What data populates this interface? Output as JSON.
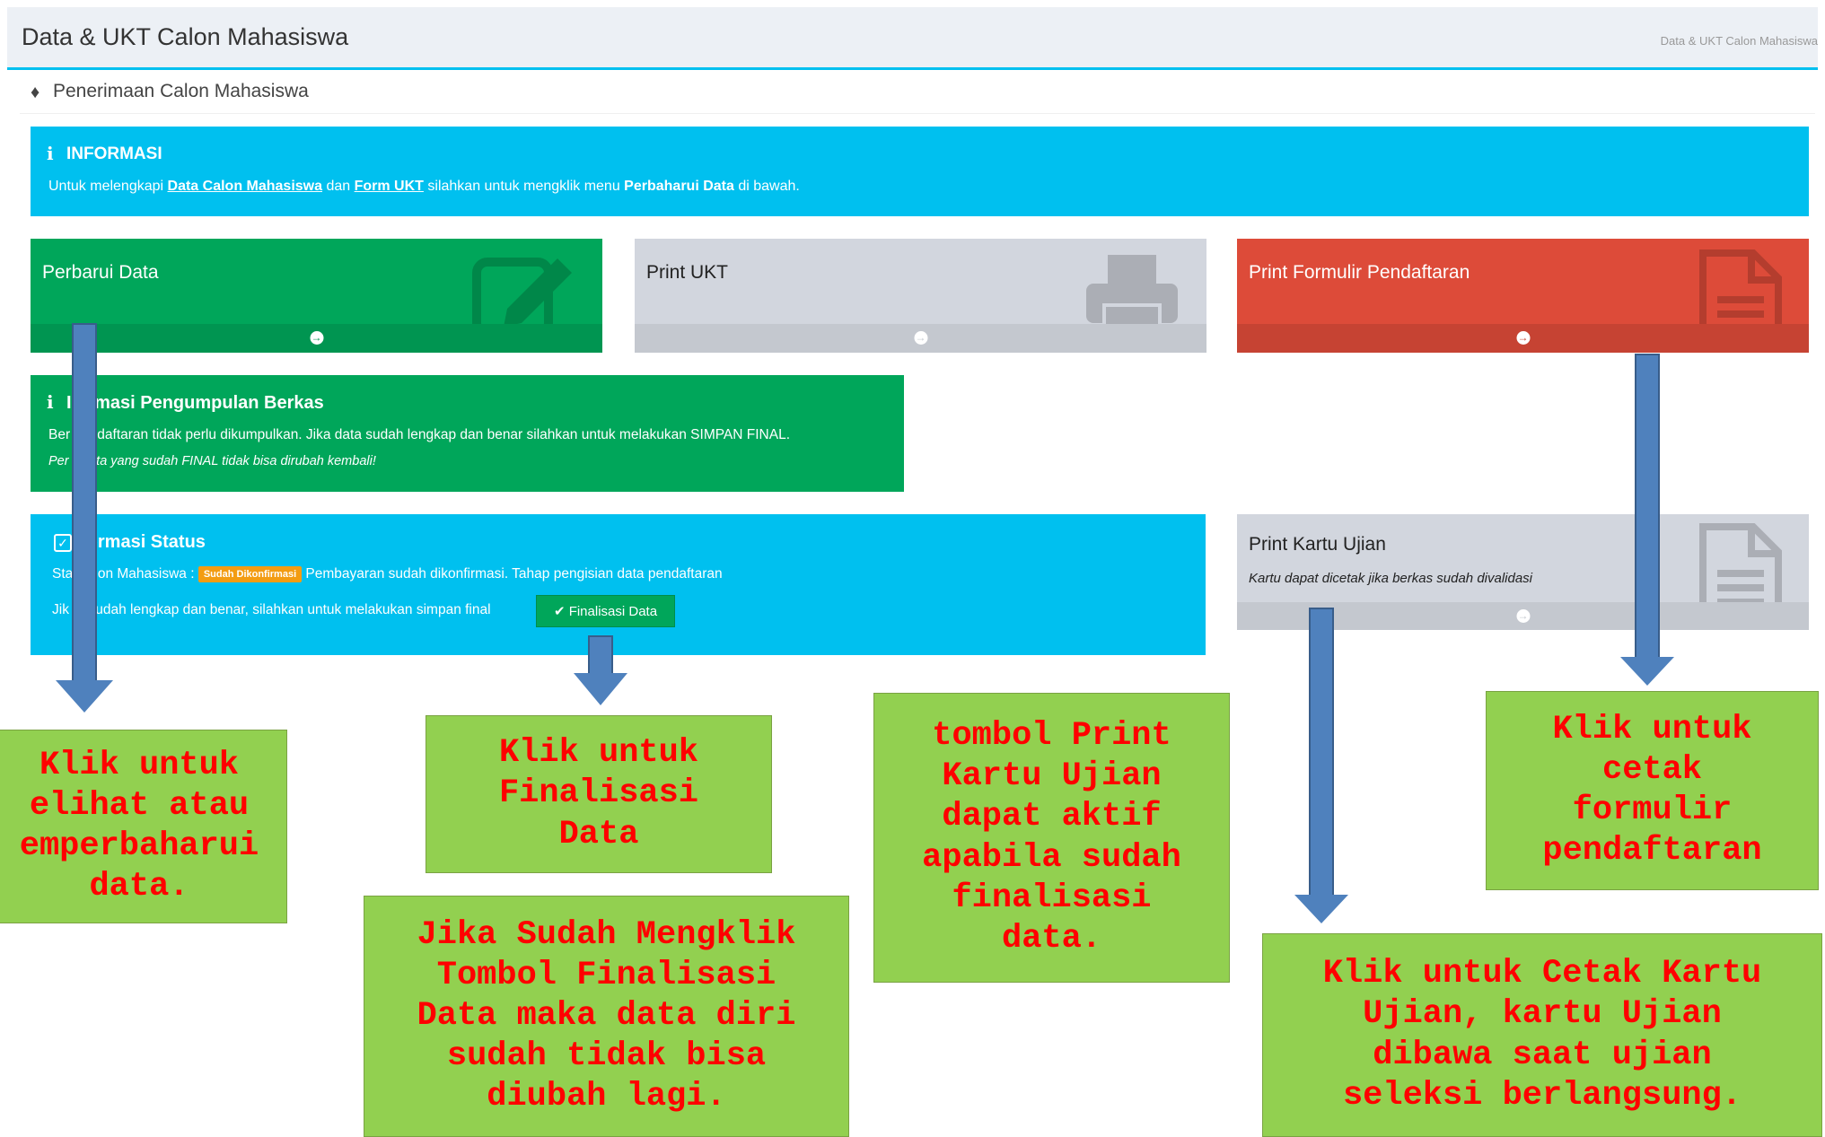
{
  "header": {
    "title": "Data & UKT Calon Mahasiswa",
    "breadcrumb": "Data & UKT Calon Mahasiswa"
  },
  "panel": {
    "title": "Penerimaan Calon Mahasiswa"
  },
  "info": {
    "title": "INFORMASI",
    "text_before": "Untuk melengkapi ",
    "link1": "Data Calon Mahasiswa",
    "text_mid": " dan ",
    "link2": "Form UKT",
    "text_after": " silahkan untuk mengklik menu ",
    "bold": "Perbaharui Data",
    "text_end": " di bawah."
  },
  "cards": {
    "perbarui": "Perbarui Data",
    "print_ukt": "Print UKT",
    "print_formulir": "Print Formulir Pendaftaran"
  },
  "berkas": {
    "title": "I  ormasi Pengumpulan Berkas",
    "text": "Ber     pendaftaran tidak perlu dikumpulkan. Jika data sudah lengkap dan benar silahkan untuk melakukan SIMPAN FINAL.",
    "note": "Per     : Data yang sudah FINAL tidak bisa dirubah kembali!"
  },
  "status": {
    "title": "formasi Status",
    "line1_prefix": "Sta     Calon Mahasiswa : ",
    "badge": "Sudah Dikonfirmasi",
    "line1_suffix": " Pembayaran sudah dikonfirmasi. Tahap pengisian data pendaftaran",
    "line2": "Jik     ta sudah lengkap dan benar, silahkan untuk melakukan simpan final",
    "button": "Finalisasi Data"
  },
  "kartu": {
    "label": "Print Kartu Ujian",
    "note": "Kartu dapat dicetak jika berkas sudah divalidasi"
  },
  "callouts": {
    "c1": "Klik untuk\nelihat atau\nemperbaharui\ndata.",
    "c2": "Klik untuk\nFinalisasi\nData",
    "c3": "Jika Sudah Mengklik\nTombol Finalisasi\nData maka data diri\nsudah tidak bisa\ndiubah lagi.",
    "c4": "tombol Print\nKartu Ujian\ndapat aktif\napabila sudah\nfinalisasi\ndata.",
    "c5": "Klik untuk\ncetak\nformulir\npendaftaran",
    "c6": "Klik untuk Cetak Kartu\nUjian, kartu Ujian\ndibawa saat ujian\nseleksi berlangsung."
  },
  "colors": {
    "aqua": "#00c0ef",
    "green": "#00a65a",
    "red": "#dd4b39",
    "gray": "#d2d6de",
    "callout_bg": "#92d050",
    "callout_text": "#ff0000",
    "arrow": "#4f81bd",
    "badge": "#f39c12"
  }
}
